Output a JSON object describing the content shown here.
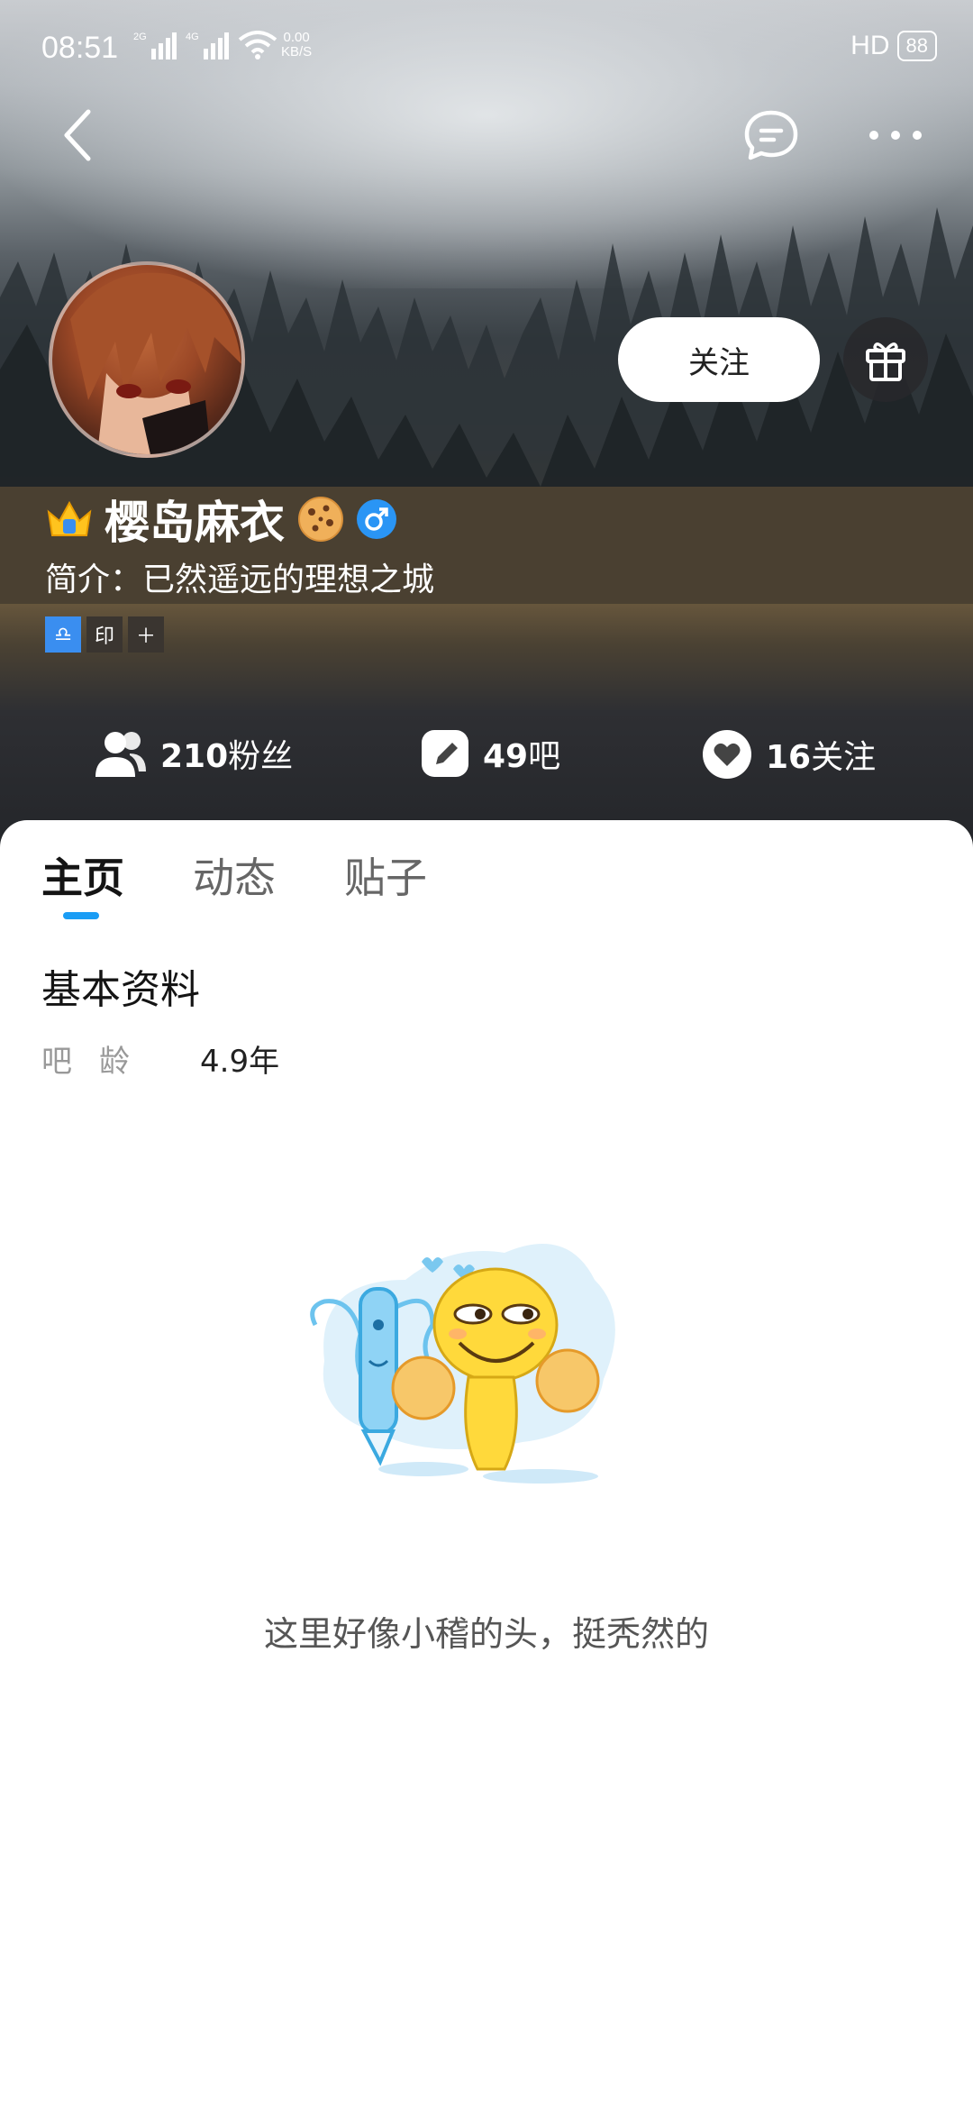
{
  "status_bar": {
    "time": "08:51",
    "network_labels": [
      "2G",
      "4G"
    ],
    "net_rate_value": "0.00",
    "net_rate_unit": "KB/S",
    "hd_label": "HD",
    "battery": "88"
  },
  "nav": {
    "back_icon": "chevron-left-icon",
    "message_icon": "chat-bubble-icon",
    "more_icon": "more-dots-icon"
  },
  "profile": {
    "username": "樱岛麻衣",
    "bio": "简介：已然遥远的理想之城",
    "badge_icon": "crown-icon",
    "emoji_icon": "cookie-icon",
    "gender_icon": "male-icon",
    "tags": [
      "♎",
      "印",
      "＋"
    ],
    "follow_label": "关注"
  },
  "stats": {
    "fans_count": "210",
    "fans_label": "粉丝",
    "bars_count": "49",
    "bars_label": "吧",
    "following_count": "16",
    "following_label": "关注"
  },
  "tabs": [
    {
      "label": "主页",
      "active": true
    },
    {
      "label": "动态",
      "active": false
    },
    {
      "label": "贴子",
      "active": false
    }
  ],
  "basic_info": {
    "title": "基本资料",
    "rows": [
      {
        "key": "吧龄",
        "value": "4.9年"
      }
    ]
  },
  "empty_state": {
    "text": "这里好像小稽的头，挺秃然的"
  },
  "colors": {
    "accent": "#1a9df5",
    "gender_badge": "#2a95f5",
    "tag_blue": "#3a8ef0",
    "tag_dark": "#3a3530"
  }
}
